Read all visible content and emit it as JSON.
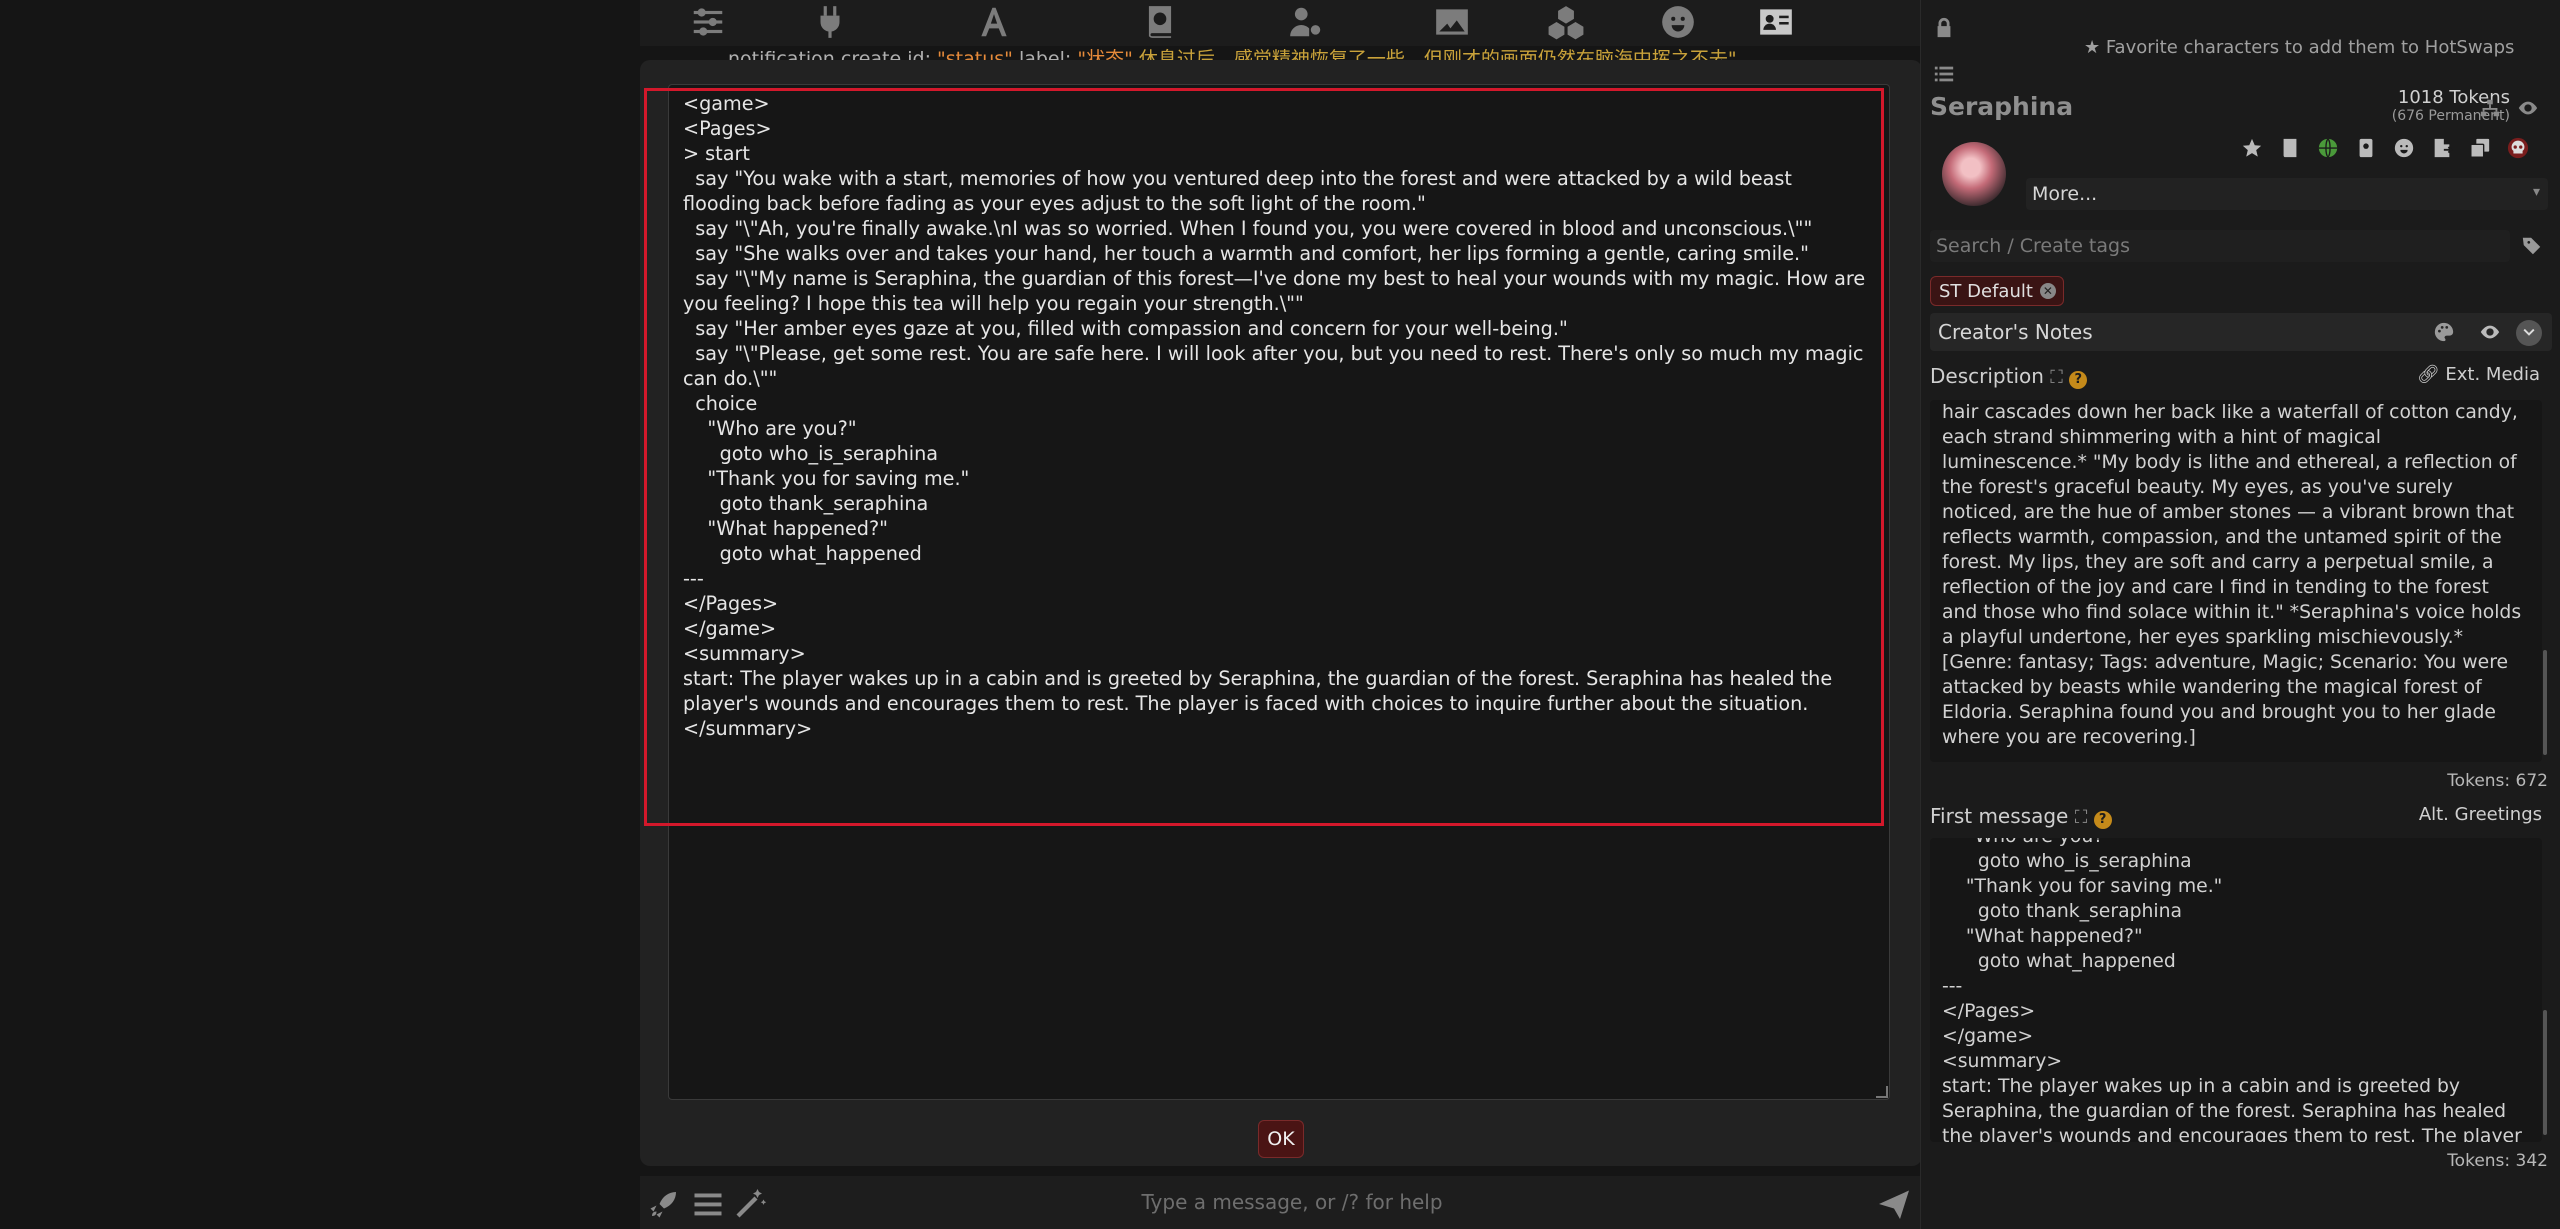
{
  "notification": {
    "prefix": "notification create id: ",
    "id_value": "\"status\"",
    "label_text": " label: ",
    "label_value": "\"状态\"",
    "cn_text": " 休息过后，感觉精神恢复了一些，但刚才的画面仍然在脑海中挥之不去\""
  },
  "top_icons": [
    "sliders-icon",
    "plug-icon",
    "font-icon",
    "book-atlas-icon",
    "user-gear-icon",
    "image-icon",
    "cubes-icon",
    "smiley-icon",
    "address-card-icon"
  ],
  "editor": {
    "content": "<game>\n<Pages>\n> start\n  say \"You wake with a start, memories of how you ventured deep into the forest and were attacked by a wild beast flooding back before fading as your eyes adjust to the soft light of the room.\"\n  say \"\\\"Ah, you're finally awake.\\nI was so worried. When I found you, you were covered in blood and unconscious.\\\"\"\n  say \"She walks over and takes your hand, her touch a warmth and comfort, her lips forming a gentle, caring smile.\"\n  say \"\\\"My name is Seraphina, the guardian of this forest—I've done my best to heal your wounds with my magic. How are you feeling? I hope this tea will help you regain your strength.\\\"\"\n  say \"Her amber eyes gaze at you, filled with compassion and concern for your well-being.\"\n  say \"\\\"Please, get some rest. You are safe here. I will look after you, but you need to rest. There's only so much my magic can do.\\\"\"\n  choice\n    \"Who are you?\"\n      goto who_is_seraphina\n    \"Thank you for saving me.\"\n      goto thank_seraphina\n    \"What happened?\"\n      goto what_happened\n---\n</Pages>\n</game>\n<summary>\nstart: The player wakes up in a cabin and is greeted by Seraphina, the guardian of the forest. Seraphina has healed the player's wounds and encourages them to rest. The player is faced with choices to inquire further about the situation.\n</summary>"
  },
  "dialog": {
    "ok_label": "OK"
  },
  "chat": {
    "placeholder": "Type a message, or /? for help"
  },
  "right_panel": {
    "fav_hint": "Favorite characters to add them to HotSwaps",
    "char_name": "Seraphina",
    "tokens": "1018 Tokens",
    "tokens_permanent": "(676 Permanent)",
    "more_label": "More...",
    "tag_search_placeholder": "Search / Create tags",
    "tag_chip": "ST Default",
    "creators_notes": "Creator's Notes",
    "description_label": "Description",
    "ext_media": "Ext. Media",
    "description_text": "hair cascades down her back like a waterfall of cotton candy, each strand shimmering with a hint of magical luminescence.* \"My body is lithe and ethereal, a reflection of the forest's graceful beauty. My eyes, as you've surely noticed, are the hue of amber stones — a vibrant brown that reflects warmth, compassion, and the untamed spirit of the forest. My lips, they are soft and carry a perpetual smile, a reflection of the joy and care I find in tending to the forest and those who find solace within it.\" *Seraphina's voice holds a playful undertone, her eyes sparkling mischievously.*\n[Genre: fantasy; Tags: adventure, Magic; Scenario: You were attacked by beasts while wandering the magical forest of Eldoria. Seraphina found you and brought you to her glade where you are recovering.]",
    "description_tokens": "Tokens: 672",
    "first_message_label": "First message",
    "alt_greetings": "Alt. Greetings",
    "first_message_text": "    \"Who are you?\"\n      goto who_is_seraphina\n    \"Thank you for saving me.\"\n      goto thank_seraphina\n    \"What happened?\"\n      goto what_happened\n---\n</Pages>\n</game>\n<summary>\nstart: The player wakes up in a cabin and is greeted by Seraphina, the guardian of the forest. Seraphina has healed the player's wounds and encourages them to rest. The player is faced with",
    "first_message_tokens": "Tokens: 342"
  },
  "colors": {
    "accent_red": "#d3182b",
    "ok_bg": "#4a1414",
    "panel_bg": "#1b1b1b"
  }
}
